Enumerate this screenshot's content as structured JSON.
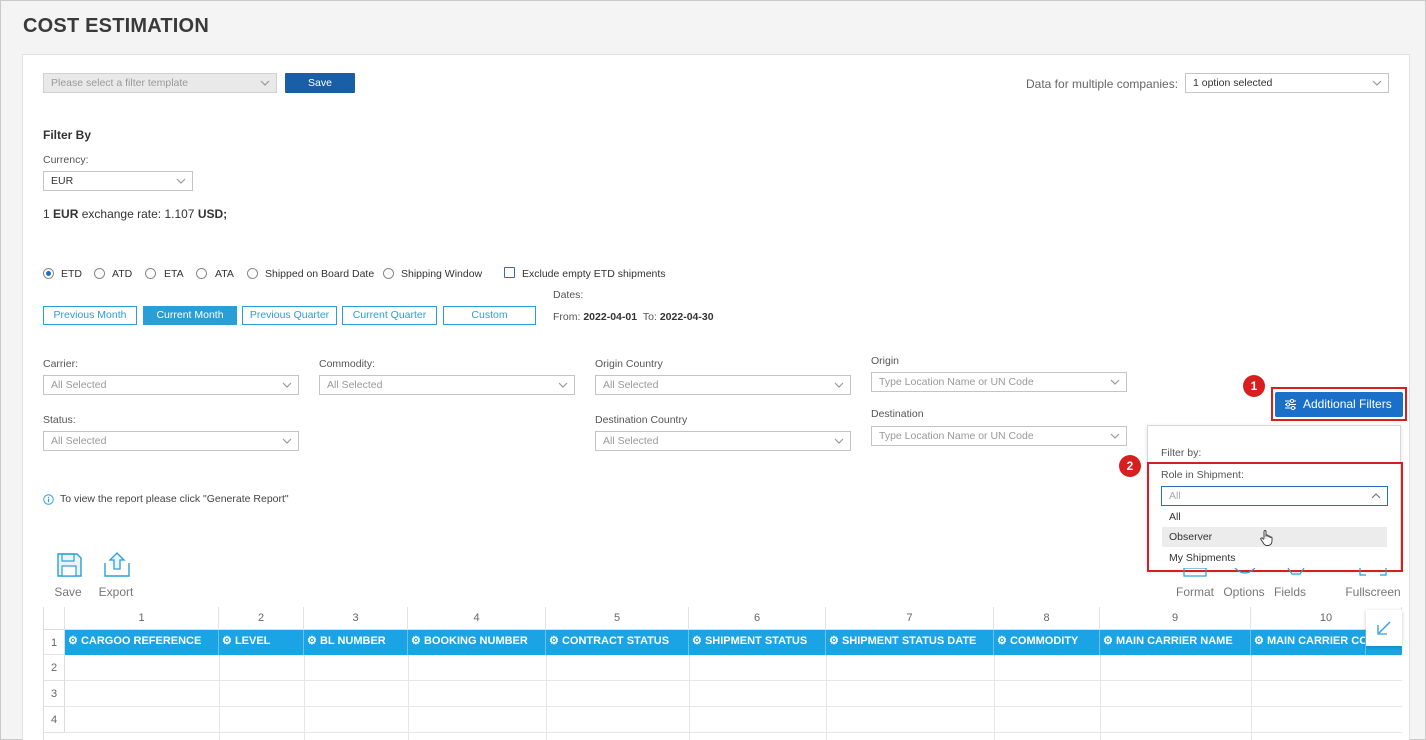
{
  "page": {
    "title": "COST ESTIMATION"
  },
  "template": {
    "placeholder": "Please select a filter template",
    "save_label": "Save"
  },
  "companies": {
    "label": "Data for multiple companies:",
    "value": "1 option selected"
  },
  "filter_by": {
    "heading": "Filter By",
    "currency_label": "Currency:",
    "currency_value": "EUR",
    "rate_prefix": "1",
    "rate_from": "EUR",
    "rate_mid": "exchange rate: 1.107",
    "rate_to": "USD;"
  },
  "date_types": {
    "options": [
      "ETD",
      "ATD",
      "ETA",
      "ATA",
      "Shipped on Board Date",
      "Shipping Window"
    ],
    "selected": "ETD",
    "exclude_label": "Exclude empty ETD shipments"
  },
  "periods": {
    "buttons": [
      "Previous Month",
      "Current Month",
      "Previous Quarter",
      "Current Quarter",
      "Custom"
    ],
    "active": "Current Month",
    "dates_label": "Dates:",
    "from_label": "From:",
    "from_value": "2022-04-01",
    "to_label": "To:",
    "to_value": "2022-04-30"
  },
  "filters": {
    "carrier": {
      "label": "Carrier:",
      "value": "All Selected"
    },
    "commodity": {
      "label": "Commodity:",
      "value": "All Selected"
    },
    "origin_country": {
      "label": "Origin Country",
      "value": "All Selected"
    },
    "origin": {
      "label": "Origin",
      "placeholder": "Type Location Name or UN Code"
    },
    "status": {
      "label": "Status:",
      "value": "All Selected"
    },
    "destination_country": {
      "label": "Destination Country",
      "value": "All Selected"
    },
    "destination": {
      "label": "Destination",
      "placeholder": "Type Location Name or UN Code"
    }
  },
  "info": {
    "text": "To view the report please click \"Generate Report\""
  },
  "additional_filters": {
    "button_label": "Additional Filters",
    "panel_heading": "Filter by:",
    "role_label": "Role in Shipment:",
    "role_value": "All",
    "options": [
      "All",
      "Observer",
      "My Shipments"
    ],
    "hovered": "Observer"
  },
  "callouts": {
    "one": "1",
    "two": "2"
  },
  "toolbar": {
    "save": "Save",
    "export": "Export",
    "format": "Format",
    "options": "Options",
    "fields": "Fields",
    "fullscreen": "Fullscreen"
  },
  "grid": {
    "col_numbers": [
      "1",
      "2",
      "3",
      "4",
      "5",
      "6",
      "7",
      "8",
      "9",
      "10"
    ],
    "headers": [
      "CARGOO REFERENCE",
      "LEVEL",
      "BL NUMBER",
      "BOOKING NUMBER",
      "CONTRACT STATUS",
      "SHIPMENT STATUS",
      "SHIPMENT STATUS DATE",
      "COMMODITY",
      "MAIN CARRIER NAME",
      "MAIN CARRIER CODE"
    ],
    "row_numbers": [
      "1",
      "2",
      "3",
      "4"
    ]
  },
  "colors": {
    "primary": "#1a6fc9",
    "header": "#1aa3e5",
    "callout": "#d62020",
    "period": "#2a9fd6"
  }
}
